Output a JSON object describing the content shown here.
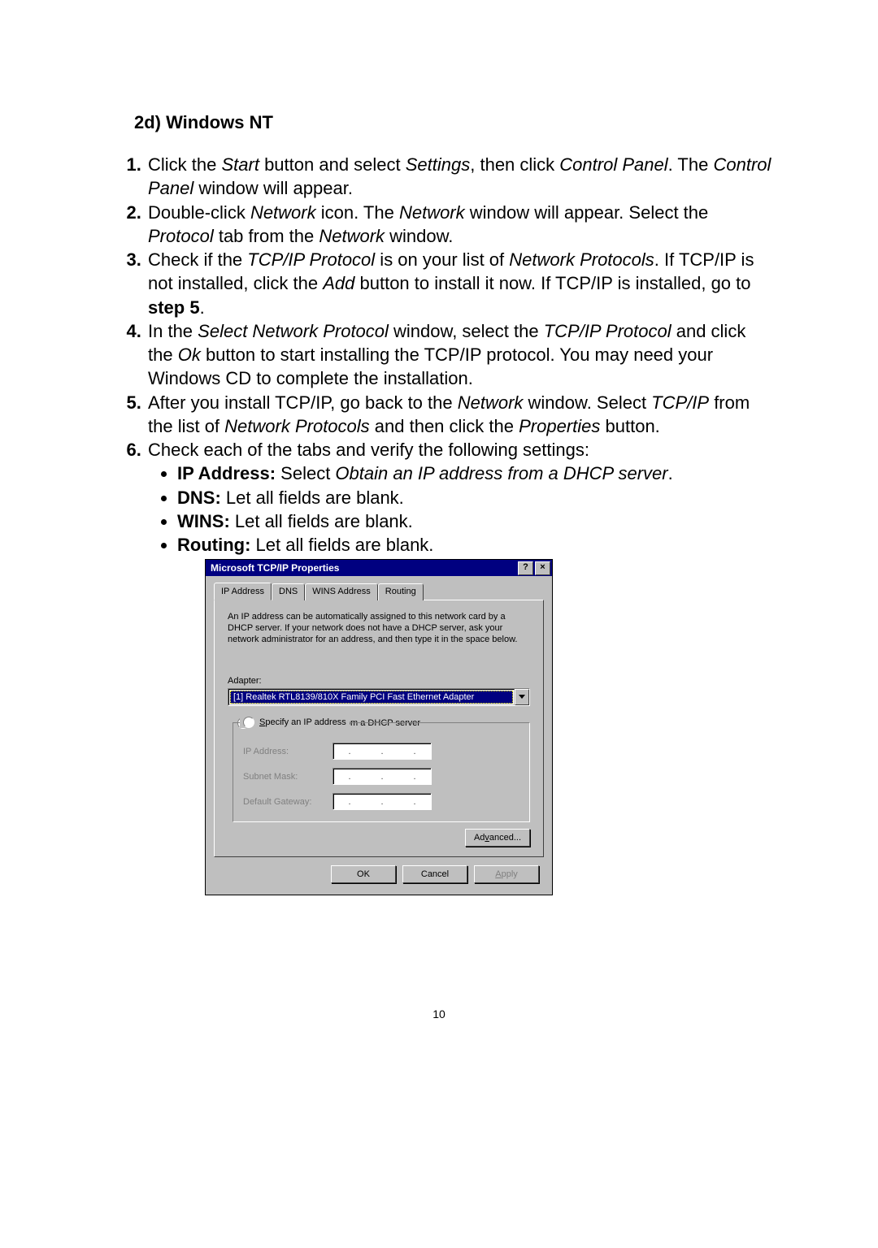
{
  "heading": "2d) Windows NT",
  "steps": {
    "s1": {
      "a": "Click the ",
      "start": "Start",
      "b": " button and select ",
      "settings": "Settings",
      "c": ", then click ",
      "cp": "Control Panel",
      "d": ". The ",
      "cp2": "Control Panel",
      "e": " window will appear."
    },
    "s2": {
      "a": "Double-click ",
      "net": "Network",
      "b": " icon. The ",
      "net2": "Network",
      "c": " window will appear. Select the ",
      "proto": "Protocol",
      "d": " tab from the ",
      "net3": "Network",
      "e": " window."
    },
    "s3": {
      "a": "Check if the ",
      "tcp": "TCP/IP Protocol",
      "b": " is on your list of ",
      "np": "Network Protocols",
      "c": ". If TCP/IP is not installed, click the ",
      "add": "Add",
      "d": " button to install it now. If TCP/IP is installed, go to ",
      "step5": "step 5",
      "e": "."
    },
    "s4": {
      "a": "In the ",
      "snp": "Select Network Protocol",
      "b": " window, select the ",
      "tcp": "TCP/IP Protocol",
      "c": " and click the ",
      "ok": "Ok",
      "d": " button to start installing the TCP/IP protocol. You may need your Windows CD to complete the installation."
    },
    "s5": {
      "a": "After you install TCP/IP, go back to the ",
      "net": "Network",
      "b": " window. Select ",
      "tcp": "TCP/IP",
      "c": " from the list of ",
      "np": "Network Protocols",
      "d": " and then click the ",
      "prop": "Properties",
      "e": " button."
    },
    "s6": {
      "lead": "Check each of the tabs and verify the following settings:",
      "b1": {
        "k": "IP Address:",
        "a": " Select ",
        "v": "Obtain an IP address from a DHCP server",
        "t": "."
      },
      "b2": {
        "k": "DNS:",
        "v": " Let all fields are blank."
      },
      "b3": {
        "k": "WINS:",
        "v": " Let all fields are blank."
      },
      "b4": {
        "k": "Routing:",
        "v": " Let all fields are blank."
      }
    }
  },
  "dialog": {
    "title": "Microsoft TCP/IP Properties",
    "help": "?",
    "close": "×",
    "tabs": {
      "ip": "IP Address",
      "dns": "DNS",
      "wins": "WINS Address",
      "routing": "Routing"
    },
    "desc": "An IP address can be automatically assigned to this network card by a DHCP server.  If your network does not have a DHCP server, ask your network administrator for an address, and then type it in the space below.",
    "adapter_label": "Adapter:",
    "adapter_value": "[1] Realtek RTL8139/810X Family PCI Fast Ethernet Adapter",
    "radio_obtain_pre": "O",
    "radio_obtain": "btain an IP address from a DHCP server",
    "radio_specify_pre": "S",
    "radio_specify": "pecify an IP address",
    "ip_label": "IP Address:",
    "subnet_label": "Subnet Mask:",
    "gw_label": "Default Gateway:",
    "advanced_pre": "Ad",
    "advanced_ul": "v",
    "advanced_post": "anced...",
    "ok": "OK",
    "cancel": "Cancel",
    "apply_ul": "A",
    "apply": "pply"
  },
  "page_number": "10"
}
